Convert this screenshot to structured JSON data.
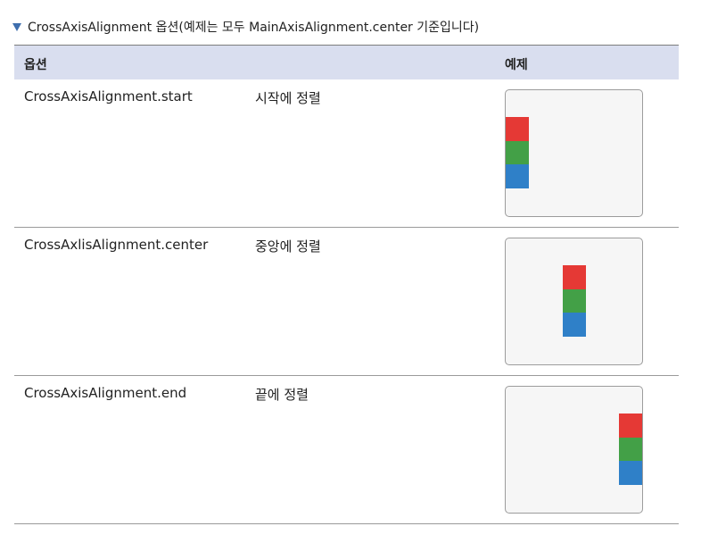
{
  "caption": {
    "text": "CrossAxisAlignment 옵션(예제는 모두 MainAxisAlignment.center 기준입니다)",
    "marker_icon": "triangle-down",
    "marker_color": "#3f6fae"
  },
  "table": {
    "headers": {
      "option": "옵션",
      "example": "예제"
    },
    "header_background": "#d9deef",
    "rows": [
      {
        "name": "CrossAxisAlignment.start",
        "description": "시작에 정렬",
        "alignment": "start"
      },
      {
        "name": "CrossAxlisAlignment.center",
        "description": "중앙에 정렬",
        "alignment": "center"
      },
      {
        "name": "CrossAxisAlignment.end",
        "description": "끝에 정렬",
        "alignment": "end"
      }
    ],
    "block_colors": [
      "#e53935",
      "#43a047",
      "#2f80c8"
    ]
  }
}
